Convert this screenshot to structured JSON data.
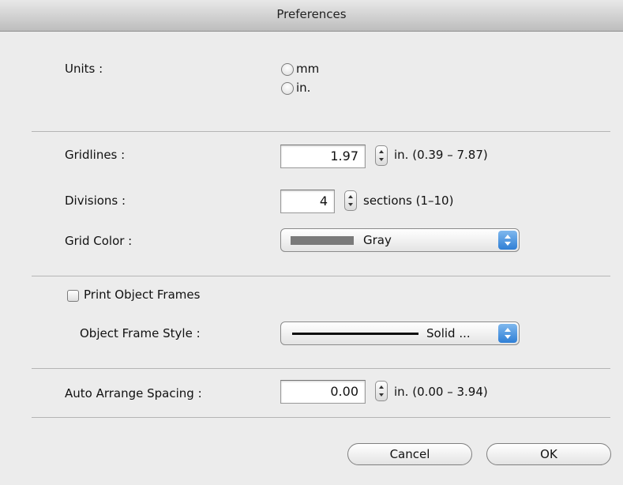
{
  "window": {
    "title": "Preferences"
  },
  "units": {
    "label": "Units :",
    "options": [
      "mm",
      "in."
    ]
  },
  "gridlines": {
    "label": "Gridlines :",
    "value": "1.97",
    "range": "in. (0.39 – 7.87)"
  },
  "divisions": {
    "label": "Divisions :",
    "value": "4",
    "range": "sections (1–10)"
  },
  "grid_color": {
    "label": "Grid Color :",
    "value": "Gray",
    "swatch": "#7a7a7a"
  },
  "print_object_frames": {
    "label": "Print Object Frames"
  },
  "object_frame_style": {
    "label": "Object Frame Style :",
    "value": "Solid ..."
  },
  "auto_arrange": {
    "label": "Auto Arrange Spacing :",
    "value": "0.00",
    "range": "in. (0.00 – 3.94)"
  },
  "buttons": {
    "cancel": "Cancel",
    "ok": "OK"
  },
  "colors": {
    "accent": "#2f7fd6"
  }
}
